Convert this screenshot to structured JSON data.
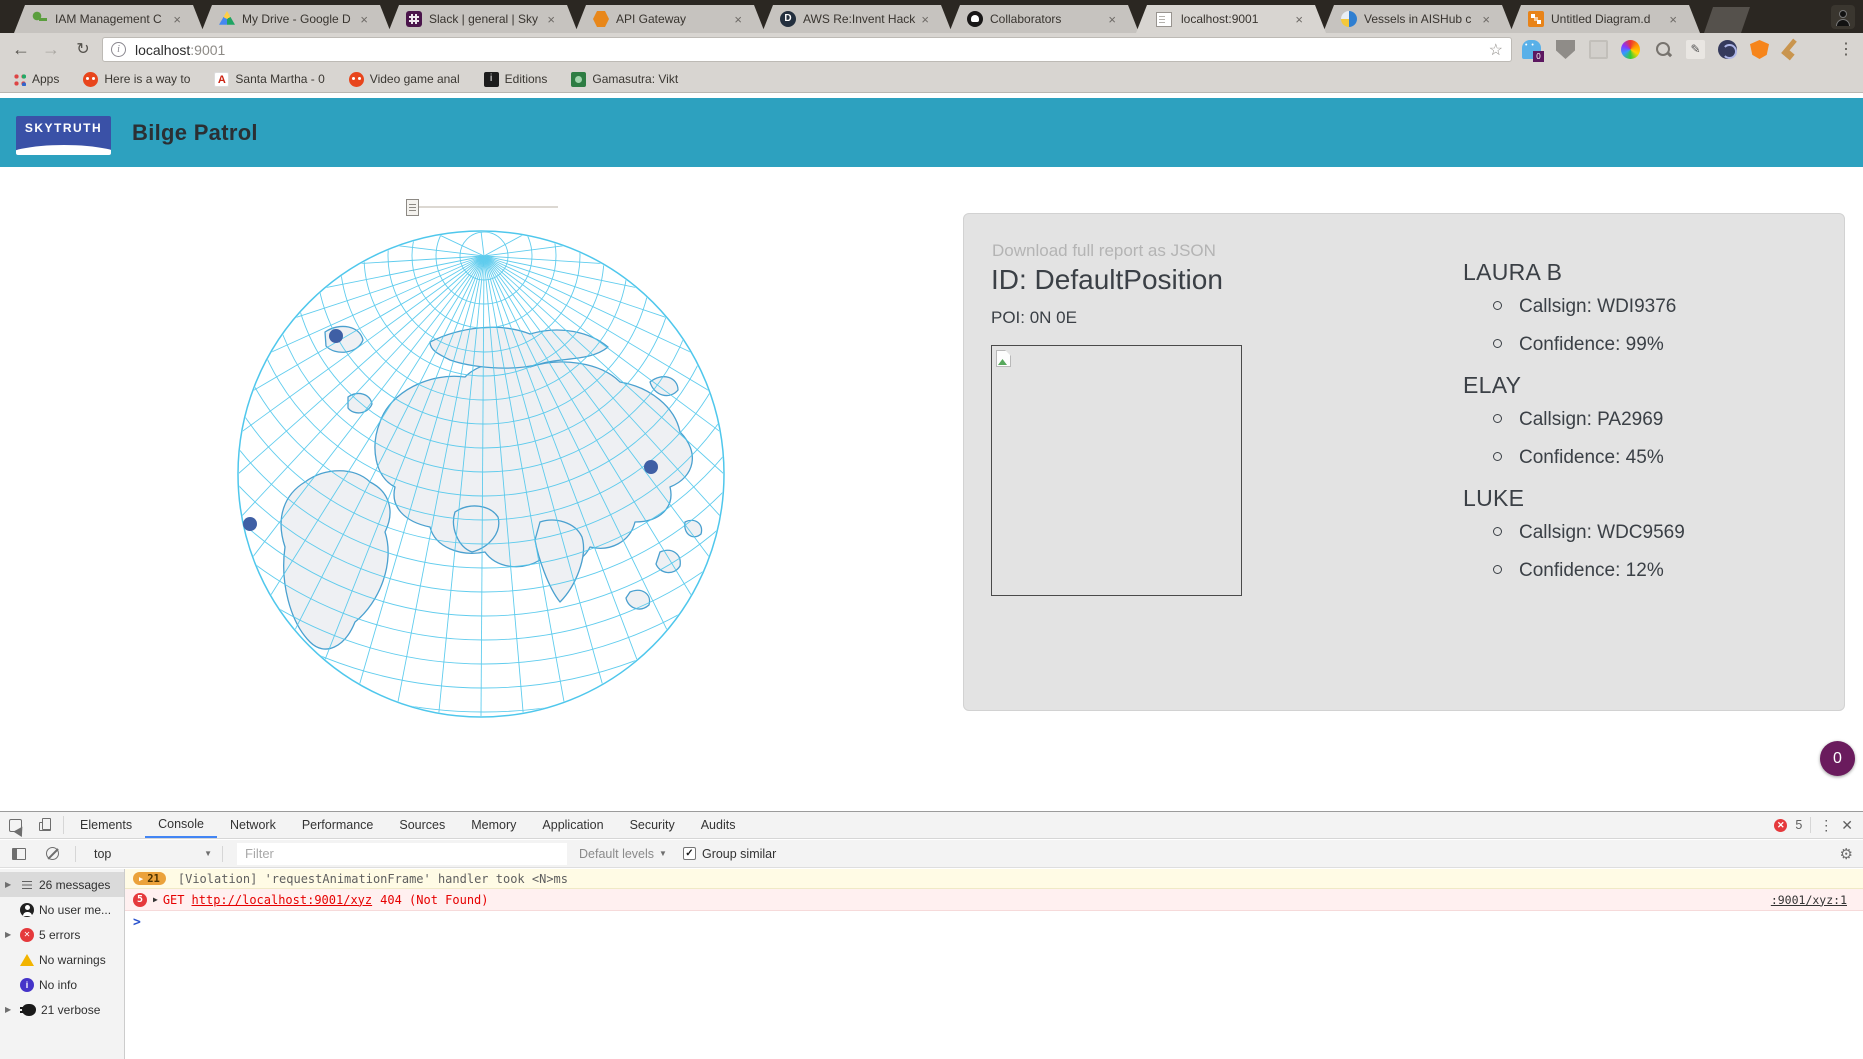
{
  "glyphs": {
    "dropdown": "▼",
    "expand": "▶",
    "check": "✓"
  },
  "browser": {
    "tabs": [
      {
        "label": "IAM Management C",
        "icon": "key-icon"
      },
      {
        "label": "My Drive - Google D",
        "icon": "drive-icon"
      },
      {
        "label": "Slack | general | Sky",
        "icon": "slack-icon"
      },
      {
        "label": "API Gateway",
        "icon": "api-gateway-icon"
      },
      {
        "label": "AWS Re:Invent Hack",
        "icon": "aws-icon"
      },
      {
        "label": "Collaborators",
        "icon": "github-icon"
      },
      {
        "label": "localhost:9001",
        "icon": "page-icon"
      },
      {
        "label": "Vessels in AISHub c",
        "icon": "aishub-icon"
      },
      {
        "label": "Untitled Diagram.d",
        "icon": "drawio-icon"
      }
    ],
    "active_tab": "localhost:9001",
    "close_glyph": "×",
    "nav": {
      "back": "←",
      "forward": "→",
      "reload": "↻"
    },
    "omnibox": {
      "info": "i",
      "host": "localhost",
      "port": ":9001",
      "star": "☆"
    },
    "extension_badge": "0",
    "menu_glyph": "⋮",
    "bookmarks": {
      "apps_label": "Apps",
      "items": [
        "Here is a way to",
        "Santa Martha - 0",
        "Video game anal",
        "Editions",
        "Gamasutra: Vikt"
      ]
    }
  },
  "page": {
    "logo_text": "SKYTRUTH",
    "title": "Bilge Patrol",
    "report": {
      "download": "Download full report as JSON",
      "id": "ID: DefaultPosition",
      "poi": "POI: 0N 0E",
      "vessels": [
        {
          "name": "LAURA B",
          "callsign": "Callsign: WDI9376",
          "confidence": "Confidence: 99%"
        },
        {
          "name": "ELAY",
          "callsign": "Callsign: PA2969",
          "confidence": "Confidence: 45%"
        },
        {
          "name": "LUKE",
          "callsign": "Callsign: WDC9569",
          "confidence": "Confidence: 12%"
        }
      ]
    },
    "overlay_badge": "0",
    "colors": {
      "header_teal": "#2da1bf",
      "logo_blue": "#3a51a7",
      "graticule": "#4fc7ec",
      "land_stroke": "#4aa0cf",
      "land_fill": "#eef0f3",
      "marker": "#3f5fa5",
      "badge_purple": "#6a1b5d"
    }
  },
  "devtools": {
    "tabs": [
      "Elements",
      "Console",
      "Network",
      "Performance",
      "Sources",
      "Memory",
      "Application",
      "Security",
      "Audits"
    ],
    "active_tab": "Console",
    "error_badge": "5",
    "menu_glyph": "⋮",
    "close_glyph": "✕",
    "toolbar": {
      "context": "top",
      "filter_placeholder": "Filter",
      "levels_label": "Default levels",
      "group_similar_label": "Group similar"
    },
    "sidebar": [
      {
        "label": "26 messages"
      },
      {
        "label": "No user me..."
      },
      {
        "label": "5 errors"
      },
      {
        "label": "No warnings"
      },
      {
        "label": "No info"
      },
      {
        "label": "21 verbose"
      }
    ],
    "console": {
      "violation": {
        "count": "21",
        "text": "[Violation] 'requestAnimationFrame' handler took <N>ms"
      },
      "error": {
        "count": "5",
        "method": "GET",
        "url": "http://localhost:9001/xyz",
        "status": "404 (Not Found)",
        "source": ":9001/xyz:1"
      },
      "prompt": ">"
    }
  }
}
